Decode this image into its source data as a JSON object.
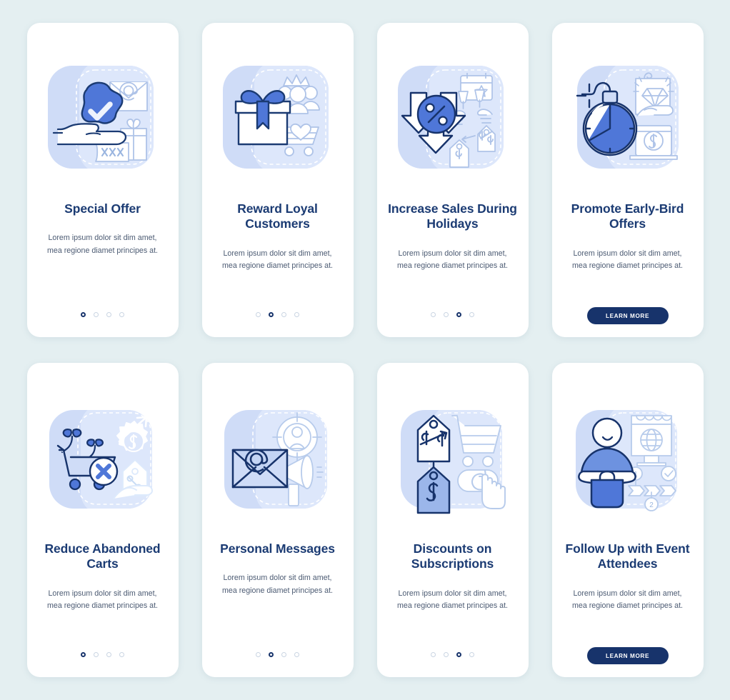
{
  "page": {
    "background_color": "#e4eff1",
    "card_background": "#ffffff",
    "title_color": "#1b3b73",
    "body_color": "#4c5b73",
    "accent_color": "#4A72D0",
    "dark_accent": "#17336b",
    "light_fill": "#cfdcf7",
    "pale_line": "#aec3e8"
  },
  "body_text": "Lorem ipsum dolor sit dim amet, mea regione diamet principes at.",
  "cta_label": "LEARN MORE",
  "cards": [
    {
      "id": "special-offer",
      "title": "Special Offer",
      "illustration": "hand-holding-star-check-envelope-gift-coupon",
      "body": "Lorem ipsum dolor sit dim amet, mea regione diamet principes at.",
      "dots": {
        "count": 4,
        "active_index": 0
      },
      "has_cta": false
    },
    {
      "id": "reward-loyal-customers",
      "title": "Reward Loyal Customers",
      "illustration": "gift-box-crown-people-cart-heart",
      "body": "Lorem ipsum dolor sit dim amet, mea regione diamet principes at.",
      "dots": {
        "count": 4,
        "active_index": 1
      },
      "has_cta": false
    },
    {
      "id": "increase-sales-during-holidays",
      "title": "Increase Sales During Holidays",
      "illustration": "down-arrows-percent-calendar-toast-pricetags",
      "body": "Lorem ipsum dolor sit dim amet, mea regione diamet principes at.",
      "dots": {
        "count": 4,
        "active_index": 2
      },
      "has_cta": false
    },
    {
      "id": "promote-early-bird-offers",
      "title": "Promote Early-Bird Offers",
      "illustration": "alarm-clock-diamond-hand-laptop-dollar",
      "body": "Lorem ipsum dolor sit dim amet, mea regione diamet principes at.",
      "dots": null,
      "has_cta": true
    },
    {
      "id": "reduce-abandoned-carts",
      "title": "Reduce Abandoned Carts",
      "illustration": "cart-sprouts-cross-gear-dollar-arrow-percent-tag",
      "body": "Lorem ipsum dolor sit dim amet, mea regione diamet principes at.",
      "dots": {
        "count": 4,
        "active_index": 0
      },
      "has_cta": false
    },
    {
      "id": "personal-messages",
      "title": "Personal Messages",
      "illustration": "envelope-at-target-person-megaphone",
      "body": "Lorem ipsum dolor sit dim amet, mea regione diamet principes at.",
      "dots": {
        "count": 4,
        "active_index": 1
      },
      "has_cta": false
    },
    {
      "id": "discounts-on-subscriptions",
      "title": "Discounts on Subscriptions",
      "illustration": "pricetag-dollar-arrow-cart-refresh-hand",
      "body": "Lorem ipsum dolor sit dim amet, mea regione diamet principes at.",
      "dots": {
        "count": 4,
        "active_index": 2
      },
      "has_cta": false
    },
    {
      "id": "follow-up-with-event-attendees",
      "title": "Follow Up with Event Attendees",
      "illustration": "person-bag-monitor-globe-steps-check",
      "body": "Lorem ipsum dolor sit dim amet, mea regione diamet principes at.",
      "dots": null,
      "has_cta": true
    }
  ]
}
